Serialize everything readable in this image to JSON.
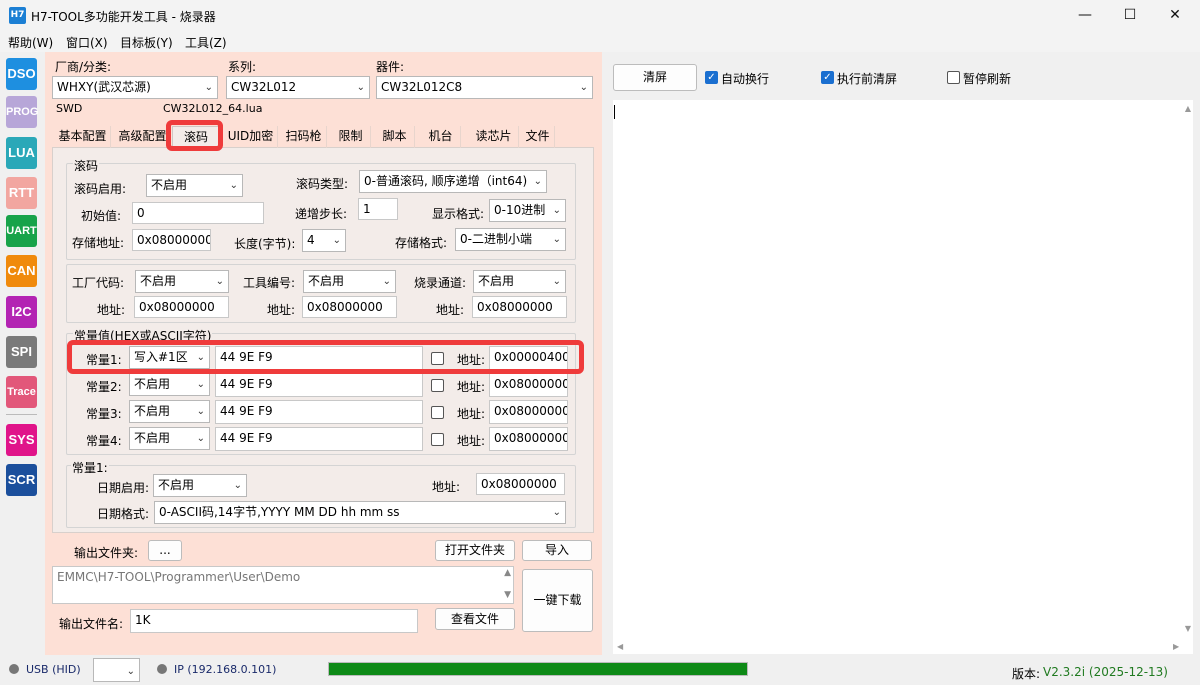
{
  "window": {
    "title": "H7-TOOL多功能开发工具 - 烧录器",
    "icon_text": "H7",
    "min": "—",
    "max": "☐",
    "close": "✕"
  },
  "menu": [
    "帮助(W)",
    "窗口(X)",
    "目标板(Y)",
    "工具(Z)"
  ],
  "sidebar": [
    {
      "label": "DSO",
      "color": "#1e8fe0"
    },
    {
      "label": "PROG",
      "color": "#b7a6d8"
    },
    {
      "label": "LUA",
      "color": "#2aa8b8"
    },
    {
      "label": "RTT",
      "color": "#f2a6a0"
    },
    {
      "label": "UART",
      "color": "#17a34a"
    },
    {
      "label": "CAN",
      "color": "#f08a0c"
    },
    {
      "label": "I2C",
      "color": "#b324b3"
    },
    {
      "label": "SPI",
      "color": "#7a7a7a"
    },
    {
      "label": "Trace",
      "color": "#e2577a"
    },
    {
      "label": "SYS",
      "color": "#e0148a"
    },
    {
      "label": "SCR",
      "color": "#1b4f9c"
    }
  ],
  "top": {
    "vendor_label": "厂商/分类:",
    "vendor_value": "WHXY(武汉芯源)",
    "series_label": "系列:",
    "series_value": "CW32L012",
    "device_label": "器件:",
    "device_value": "CW32L012C8",
    "interface": "SWD",
    "lua_file": "CW32L012_64.lua"
  },
  "tabs": [
    "基本配置",
    "高级配置",
    "滚码",
    "UID加密",
    "扫码枪",
    "限制",
    "脚本",
    "机台",
    "读芯片",
    "文件"
  ],
  "rolling": {
    "group_title": "滚码",
    "enable_label": "滚码启用:",
    "enable_value": "不启用",
    "type_label": "滚码类型:",
    "type_value": "0-普通滚码, 顺序递增（int64)",
    "init_label": "初始值:",
    "init_value": "0",
    "step_label": "递增步长:",
    "step_value": "1",
    "display_label": "显示格式:",
    "display_value": "0-10进制",
    "addr_label": "存储地址:",
    "addr_value": "0x08000000",
    "len_label": "长度(字节):",
    "len_value": "4",
    "store_label": "存储格式:",
    "store_value": "0-二进制小端"
  },
  "factory": {
    "code_label": "工厂代码:",
    "code_value": "不启用",
    "tool_label": "工具编号:",
    "tool_value": "不启用",
    "channel_label": "烧录通道:",
    "channel_value": "不启用",
    "addr_label": "地址:",
    "addr1": "0x08000000",
    "addr2": "0x08000000",
    "addr3": "0x08000000"
  },
  "constants": {
    "group_title": "常量值(HEX或ASCII字符)",
    "rows": [
      {
        "label": "常量1:",
        "mode": "写入#1区",
        "value": "44 9E F9",
        "addr_label": "地址:",
        "addr": "0x00000400"
      },
      {
        "label": "常量2:",
        "mode": "不启用",
        "value": "44 9E F9",
        "addr_label": "地址:",
        "addr": "0x08000000"
      },
      {
        "label": "常量3:",
        "mode": "不启用",
        "value": "44 9E F9",
        "addr_label": "地址:",
        "addr": "0x08000000"
      },
      {
        "label": "常量4:",
        "mode": "不启用",
        "value": "44 9E F9",
        "addr_label": "地址:",
        "addr": "0x08000000"
      }
    ]
  },
  "date": {
    "group_title": "常量1:",
    "enable_label": "日期启用:",
    "enable_value": "不启用",
    "addr_label": "地址:",
    "addr_value": "0x08000000",
    "format_label": "日期格式:",
    "format_value": "0-ASCII码,14字节,YYYY MM DD hh mm ss"
  },
  "output": {
    "folder_label": "输出文件夹:",
    "browse": "...",
    "open_folder": "打开文件夹",
    "import": "导入",
    "path": "EMMC\\H7-TOOL\\Programmer\\User\\Demo",
    "download": "一键下载",
    "filename_label": "输出文件名:",
    "filename_value": "1K",
    "view_file": "查看文件"
  },
  "right": {
    "clear": "清屏",
    "auto_wrap": "自动换行",
    "clear_before": "执行前清屏",
    "pause": "暂停刷新"
  },
  "status": {
    "usb": "USB (HID)",
    "ip": "IP (192.168.0.101)",
    "version_label": "版本:",
    "version_value": "V2.3.2i (2025-12-13)",
    "progress": 1.0
  }
}
